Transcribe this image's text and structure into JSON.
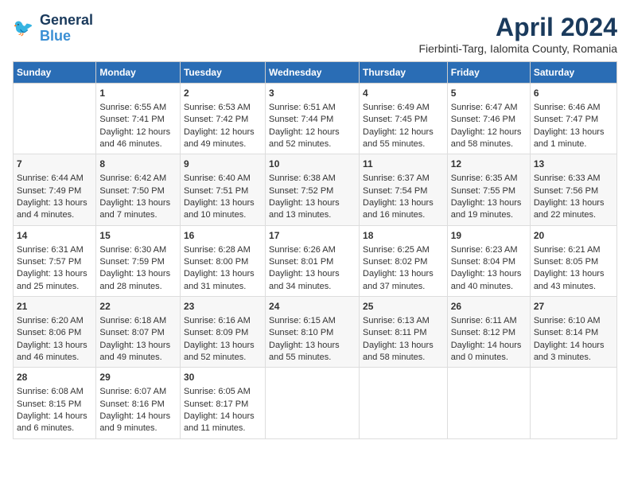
{
  "header": {
    "logo_line1": "General",
    "logo_line2": "Blue",
    "title": "April 2024",
    "subtitle": "Fierbinti-Targ, Ialomita County, Romania"
  },
  "columns": [
    "Sunday",
    "Monday",
    "Tuesday",
    "Wednesday",
    "Thursday",
    "Friday",
    "Saturday"
  ],
  "weeks": [
    [
      {
        "day": "",
        "info": ""
      },
      {
        "day": "1",
        "info": "Sunrise: 6:55 AM\nSunset: 7:41 PM\nDaylight: 12 hours and 46 minutes."
      },
      {
        "day": "2",
        "info": "Sunrise: 6:53 AM\nSunset: 7:42 PM\nDaylight: 12 hours and 49 minutes."
      },
      {
        "day": "3",
        "info": "Sunrise: 6:51 AM\nSunset: 7:44 PM\nDaylight: 12 hours and 52 minutes."
      },
      {
        "day": "4",
        "info": "Sunrise: 6:49 AM\nSunset: 7:45 PM\nDaylight: 12 hours and 55 minutes."
      },
      {
        "day": "5",
        "info": "Sunrise: 6:47 AM\nSunset: 7:46 PM\nDaylight: 12 hours and 58 minutes."
      },
      {
        "day": "6",
        "info": "Sunrise: 6:46 AM\nSunset: 7:47 PM\nDaylight: 13 hours and 1 minute."
      }
    ],
    [
      {
        "day": "7",
        "info": "Sunrise: 6:44 AM\nSunset: 7:49 PM\nDaylight: 13 hours and 4 minutes."
      },
      {
        "day": "8",
        "info": "Sunrise: 6:42 AM\nSunset: 7:50 PM\nDaylight: 13 hours and 7 minutes."
      },
      {
        "day": "9",
        "info": "Sunrise: 6:40 AM\nSunset: 7:51 PM\nDaylight: 13 hours and 10 minutes."
      },
      {
        "day": "10",
        "info": "Sunrise: 6:38 AM\nSunset: 7:52 PM\nDaylight: 13 hours and 13 minutes."
      },
      {
        "day": "11",
        "info": "Sunrise: 6:37 AM\nSunset: 7:54 PM\nDaylight: 13 hours and 16 minutes."
      },
      {
        "day": "12",
        "info": "Sunrise: 6:35 AM\nSunset: 7:55 PM\nDaylight: 13 hours and 19 minutes."
      },
      {
        "day": "13",
        "info": "Sunrise: 6:33 AM\nSunset: 7:56 PM\nDaylight: 13 hours and 22 minutes."
      }
    ],
    [
      {
        "day": "14",
        "info": "Sunrise: 6:31 AM\nSunset: 7:57 PM\nDaylight: 13 hours and 25 minutes."
      },
      {
        "day": "15",
        "info": "Sunrise: 6:30 AM\nSunset: 7:59 PM\nDaylight: 13 hours and 28 minutes."
      },
      {
        "day": "16",
        "info": "Sunrise: 6:28 AM\nSunset: 8:00 PM\nDaylight: 13 hours and 31 minutes."
      },
      {
        "day": "17",
        "info": "Sunrise: 6:26 AM\nSunset: 8:01 PM\nDaylight: 13 hours and 34 minutes."
      },
      {
        "day": "18",
        "info": "Sunrise: 6:25 AM\nSunset: 8:02 PM\nDaylight: 13 hours and 37 minutes."
      },
      {
        "day": "19",
        "info": "Sunrise: 6:23 AM\nSunset: 8:04 PM\nDaylight: 13 hours and 40 minutes."
      },
      {
        "day": "20",
        "info": "Sunrise: 6:21 AM\nSunset: 8:05 PM\nDaylight: 13 hours and 43 minutes."
      }
    ],
    [
      {
        "day": "21",
        "info": "Sunrise: 6:20 AM\nSunset: 8:06 PM\nDaylight: 13 hours and 46 minutes."
      },
      {
        "day": "22",
        "info": "Sunrise: 6:18 AM\nSunset: 8:07 PM\nDaylight: 13 hours and 49 minutes."
      },
      {
        "day": "23",
        "info": "Sunrise: 6:16 AM\nSunset: 8:09 PM\nDaylight: 13 hours and 52 minutes."
      },
      {
        "day": "24",
        "info": "Sunrise: 6:15 AM\nSunset: 8:10 PM\nDaylight: 13 hours and 55 minutes."
      },
      {
        "day": "25",
        "info": "Sunrise: 6:13 AM\nSunset: 8:11 PM\nDaylight: 13 hours and 58 minutes."
      },
      {
        "day": "26",
        "info": "Sunrise: 6:11 AM\nSunset: 8:12 PM\nDaylight: 14 hours and 0 minutes."
      },
      {
        "day": "27",
        "info": "Sunrise: 6:10 AM\nSunset: 8:14 PM\nDaylight: 14 hours and 3 minutes."
      }
    ],
    [
      {
        "day": "28",
        "info": "Sunrise: 6:08 AM\nSunset: 8:15 PM\nDaylight: 14 hours and 6 minutes."
      },
      {
        "day": "29",
        "info": "Sunrise: 6:07 AM\nSunset: 8:16 PM\nDaylight: 14 hours and 9 minutes."
      },
      {
        "day": "30",
        "info": "Sunrise: 6:05 AM\nSunset: 8:17 PM\nDaylight: 14 hours and 11 minutes."
      },
      {
        "day": "",
        "info": ""
      },
      {
        "day": "",
        "info": ""
      },
      {
        "day": "",
        "info": ""
      },
      {
        "day": "",
        "info": ""
      }
    ]
  ]
}
